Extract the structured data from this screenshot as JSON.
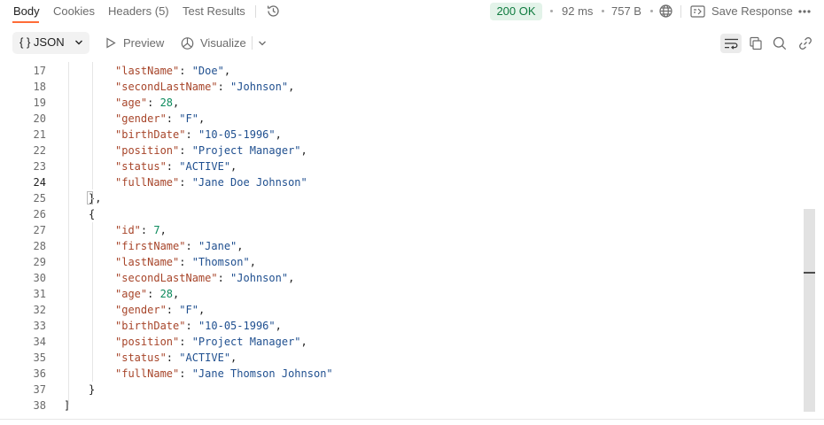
{
  "tabs": [
    {
      "label": "Body"
    },
    {
      "label": "Cookies"
    },
    {
      "label": "Headers (5)"
    },
    {
      "label": "Test Results"
    }
  ],
  "status": {
    "code_label": "200 OK",
    "time": "92 ms",
    "size": "757 B",
    "color": "#0f7b3f"
  },
  "save_response_label": "Save Response",
  "toolbar": {
    "format_label": "{ }  JSON",
    "preview_label": "Preview",
    "visualize_label": "Visualize"
  },
  "icons": {
    "history": "history-icon",
    "globe": "globe-icon",
    "save": "save-response-icon",
    "more": "more-icon",
    "wrap": "wrap-lines-icon",
    "copy": "copy-icon",
    "search": "search-icon",
    "link": "link-icon"
  },
  "code": {
    "lines": [
      {
        "num": "17",
        "tokens": [
          {
            "t": "\"lastName\"",
            "c": "key"
          },
          {
            "t": ": ",
            "c": "pun"
          },
          {
            "t": "\"Doe\"",
            "c": "str"
          },
          {
            "t": ",",
            "c": "pun"
          }
        ]
      },
      {
        "num": "18",
        "tokens": [
          {
            "t": "\"secondLastName\"",
            "c": "key"
          },
          {
            "t": ": ",
            "c": "pun"
          },
          {
            "t": "\"Johnson\"",
            "c": "str"
          },
          {
            "t": ",",
            "c": "pun"
          }
        ]
      },
      {
        "num": "19",
        "tokens": [
          {
            "t": "\"age\"",
            "c": "key"
          },
          {
            "t": ": ",
            "c": "pun"
          },
          {
            "t": "28",
            "c": "num"
          },
          {
            "t": ",",
            "c": "pun"
          }
        ]
      },
      {
        "num": "20",
        "tokens": [
          {
            "t": "\"gender\"",
            "c": "key"
          },
          {
            "t": ": ",
            "c": "pun"
          },
          {
            "t": "\"F\"",
            "c": "str"
          },
          {
            "t": ",",
            "c": "pun"
          }
        ]
      },
      {
        "num": "21",
        "tokens": [
          {
            "t": "\"birthDate\"",
            "c": "key"
          },
          {
            "t": ": ",
            "c": "pun"
          },
          {
            "t": "\"10-05-1996\"",
            "c": "str"
          },
          {
            "t": ",",
            "c": "pun"
          }
        ]
      },
      {
        "num": "22",
        "tokens": [
          {
            "t": "\"position\"",
            "c": "key"
          },
          {
            "t": ": ",
            "c": "pun"
          },
          {
            "t": "\"Project Manager\"",
            "c": "str"
          },
          {
            "t": ",",
            "c": "pun"
          }
        ]
      },
      {
        "num": "23",
        "tokens": [
          {
            "t": "\"status\"",
            "c": "key"
          },
          {
            "t": ": ",
            "c": "pun"
          },
          {
            "t": "\"ACTIVE\"",
            "c": "str"
          },
          {
            "t": ",",
            "c": "pun"
          }
        ]
      },
      {
        "num": "24",
        "tokens": [
          {
            "t": "\"fullName\"",
            "c": "key"
          },
          {
            "t": ": ",
            "c": "pun"
          },
          {
            "t": "\"Jane Doe Johnson\"",
            "c": "str"
          }
        ]
      },
      {
        "num": "25",
        "tokens": [
          {
            "t": "},",
            "c": "pun"
          }
        ]
      },
      {
        "num": "26",
        "tokens": [
          {
            "t": "{",
            "c": "pun"
          }
        ]
      },
      {
        "num": "27",
        "tokens": [
          {
            "t": "\"id\"",
            "c": "key"
          },
          {
            "t": ": ",
            "c": "pun"
          },
          {
            "t": "7",
            "c": "num"
          },
          {
            "t": ",",
            "c": "pun"
          }
        ]
      },
      {
        "num": "28",
        "tokens": [
          {
            "t": "\"firstName\"",
            "c": "key"
          },
          {
            "t": ": ",
            "c": "pun"
          },
          {
            "t": "\"Jane\"",
            "c": "str"
          },
          {
            "t": ",",
            "c": "pun"
          }
        ]
      },
      {
        "num": "29",
        "tokens": [
          {
            "t": "\"lastName\"",
            "c": "key"
          },
          {
            "t": ": ",
            "c": "pun"
          },
          {
            "t": "\"Thomson\"",
            "c": "str"
          },
          {
            "t": ",",
            "c": "pun"
          }
        ]
      },
      {
        "num": "30",
        "tokens": [
          {
            "t": "\"secondLastName\"",
            "c": "key"
          },
          {
            "t": ": ",
            "c": "pun"
          },
          {
            "t": "\"Johnson\"",
            "c": "str"
          },
          {
            "t": ",",
            "c": "pun"
          }
        ]
      },
      {
        "num": "31",
        "tokens": [
          {
            "t": "\"age\"",
            "c": "key"
          },
          {
            "t": ": ",
            "c": "pun"
          },
          {
            "t": "28",
            "c": "num"
          },
          {
            "t": ",",
            "c": "pun"
          }
        ]
      },
      {
        "num": "32",
        "tokens": [
          {
            "t": "\"gender\"",
            "c": "key"
          },
          {
            "t": ": ",
            "c": "pun"
          },
          {
            "t": "\"F\"",
            "c": "str"
          },
          {
            "t": ",",
            "c": "pun"
          }
        ]
      },
      {
        "num": "33",
        "tokens": [
          {
            "t": "\"birthDate\"",
            "c": "key"
          },
          {
            "t": ": ",
            "c": "pun"
          },
          {
            "t": "\"10-05-1996\"",
            "c": "str"
          },
          {
            "t": ",",
            "c": "pun"
          }
        ]
      },
      {
        "num": "34",
        "tokens": [
          {
            "t": "\"position\"",
            "c": "key"
          },
          {
            "t": ": ",
            "c": "pun"
          },
          {
            "t": "\"Project Manager\"",
            "c": "str"
          },
          {
            "t": ",",
            "c": "pun"
          }
        ]
      },
      {
        "num": "35",
        "tokens": [
          {
            "t": "\"status\"",
            "c": "key"
          },
          {
            "t": ": ",
            "c": "pun"
          },
          {
            "t": "\"ACTIVE\"",
            "c": "str"
          },
          {
            "t": ",",
            "c": "pun"
          }
        ]
      },
      {
        "num": "36",
        "tokens": [
          {
            "t": "\"fullName\"",
            "c": "key"
          },
          {
            "t": ": ",
            "c": "pun"
          },
          {
            "t": "\"Jane Thomson Johnson\"",
            "c": "str"
          }
        ]
      },
      {
        "num": "37",
        "tokens": [
          {
            "t": "}",
            "c": "pun"
          }
        ]
      },
      {
        "num": "38",
        "tokens": [
          {
            "t": "]",
            "c": "pun"
          }
        ]
      }
    ]
  }
}
